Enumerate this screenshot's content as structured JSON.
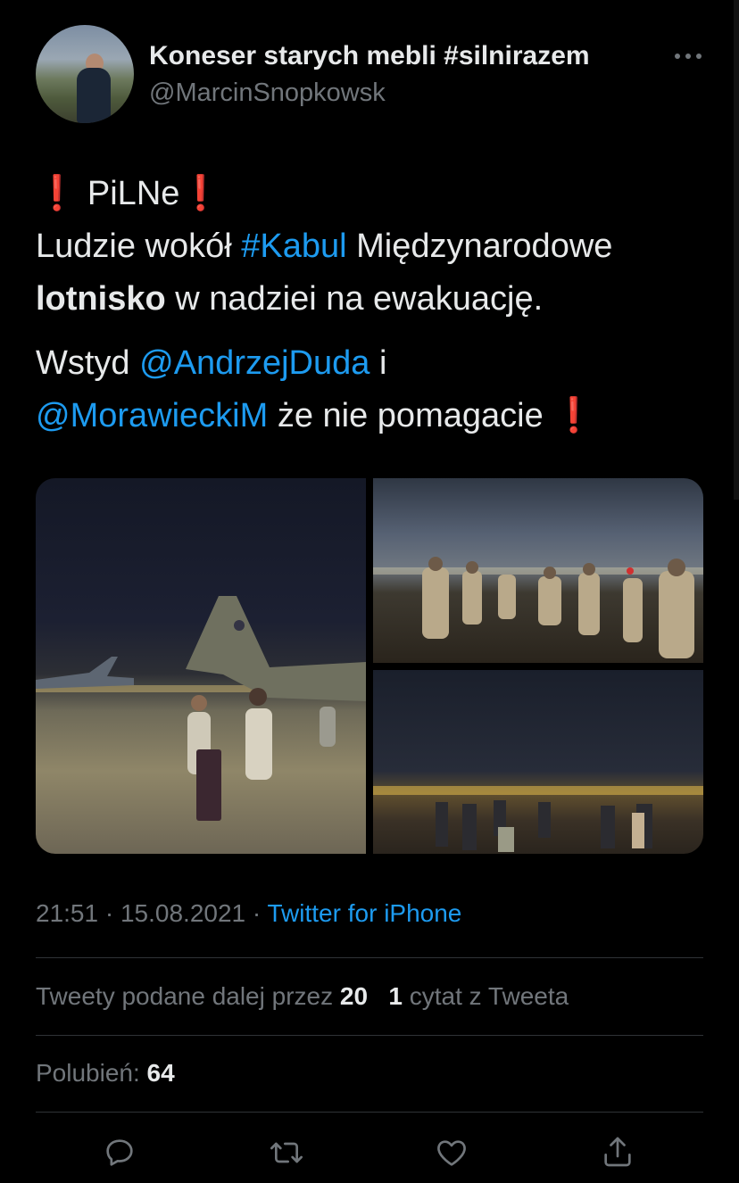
{
  "author": {
    "display_name": "Koneser starych mebli #silnirazem",
    "handle": "@MarcinSnopkowsk"
  },
  "tweet": {
    "line1_text": "PiLNe",
    "line2_prefix": "Ludzie wokół ",
    "line2_hashtag": "#Kabul",
    "line2_suffix": " Międzynarodowe",
    "line3_bold": "lotnisko",
    "line3_suffix": " w nadziei na ewakuację.",
    "line4_prefix": "Wstyd ",
    "line4_mention": "@AndrzejDuda",
    "line4_suffix": " i",
    "line5_mention": "@MorawieckiM",
    "line5_suffix": " że nie pomagacie  "
  },
  "meta": {
    "time": "21:51",
    "date": "15.08.2021",
    "separator": " · ",
    "source": "Twitter for iPhone"
  },
  "stats": {
    "retweets_prefix": "Tweety podane dalej przez ",
    "retweets_count": "20",
    "quotes_count": "1",
    "quotes_label": " cytat z Tweeta",
    "likes_label": "Polubień: ",
    "likes_count": "64"
  },
  "icons": {
    "more": "more-icon",
    "reply": "reply-icon",
    "retweet": "retweet-icon",
    "like": "like-icon",
    "share": "share-icon",
    "alert": "exclamation-icon"
  },
  "colors": {
    "background": "#000000",
    "text": "#e7e9ea",
    "secondary": "#71767b",
    "link": "#1d9bf0",
    "alert": "#e0252d",
    "divider": "#2f3336"
  }
}
